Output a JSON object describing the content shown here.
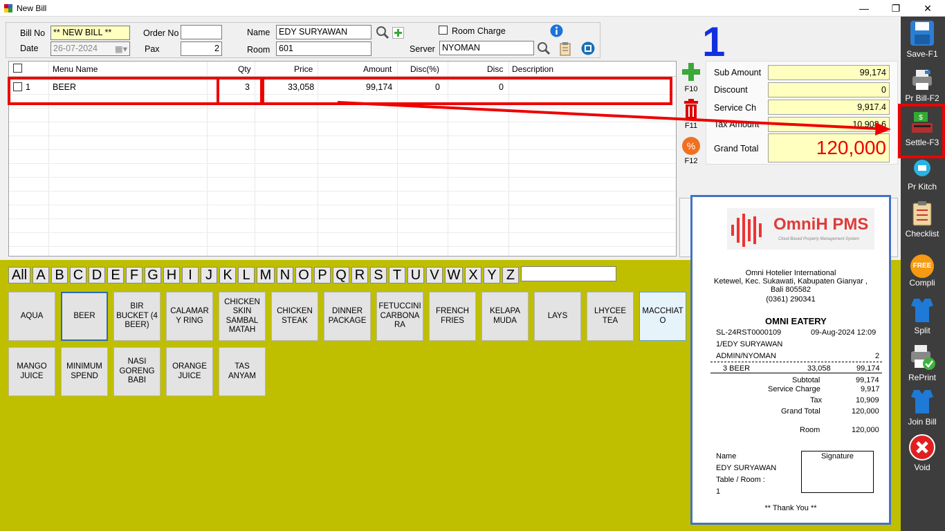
{
  "window": {
    "title": "New Bill",
    "minimize": "—",
    "maximize": "❐",
    "close": "✕"
  },
  "header": {
    "bill_no_label": "Bill No",
    "bill_no_value": "** NEW BILL **",
    "date_label": "Date",
    "date_value": "26-07-2024",
    "order_no_label": "Order No",
    "order_no_value": "",
    "pax_label": "Pax",
    "pax_value": "2",
    "name_label": "Name",
    "name_value": "EDY SURYAWAN",
    "room_label": "Room",
    "room_value": "601",
    "room_charge_label": "Room Charge",
    "server_label": "Server",
    "server_value": "NYOMAN",
    "big_number": "1"
  },
  "grid": {
    "columns": [
      "Menu Name",
      "Qty",
      "Price",
      "Amount",
      "Disc(%)",
      "Disc",
      "Description"
    ],
    "rows": [
      {
        "no": "1",
        "menu": "BEER",
        "qty": "3",
        "price": "33,058",
        "amount": "99,174",
        "disc_pct": "0",
        "disc": "0",
        "description": ""
      }
    ]
  },
  "fkeys": {
    "f10": "F10",
    "f11": "F11",
    "f12": "F12"
  },
  "totals": {
    "sub_amount_label": "Sub Amount",
    "sub_amount": "99,174",
    "discount_label": "Discount",
    "discount": "0",
    "service_label": "Service Ch",
    "service": "9,917.4",
    "tax_label": "Tax Amount",
    "tax": "10,908.6",
    "grand_label": "Grand Total",
    "grand": "120,000"
  },
  "alphabet": [
    "All",
    "A",
    "B",
    "C",
    "D",
    "E",
    "F",
    "G",
    "H",
    "I",
    "J",
    "K",
    "L",
    "M",
    "N",
    "O",
    "P",
    "Q",
    "R",
    "S",
    "T",
    "U",
    "V",
    "W",
    "X",
    "Y",
    "Z"
  ],
  "menu_items": [
    "AQUA",
    "BEER",
    "BIR BUCKET (4 BEER)",
    "CALAMAR Y RING",
    "CHICKEN SKIN SAMBAL MATAH",
    "CHICKEN STEAK",
    "DINNER PACKAGE",
    "FETUCCINI CARBONA RA",
    "FRENCH FRIES",
    "KELAPA MUDA",
    "LAYS",
    "LHYCEE TEA",
    "MACCHIAT O",
    "MANGO JUICE",
    "MINIMUM SPEND",
    "NASI GORENG BABI",
    "ORANGE JUICE",
    "TAS ANYAM"
  ],
  "sidebar": {
    "save": "Save-F1",
    "print_bill": "Pr Bill-F2",
    "settle": "Settle-F3",
    "print_kitchen": "Pr Kitch",
    "checklist": "Checklist",
    "free_badge": "FREE",
    "compli": "Compli",
    "split": "Split",
    "reprint": "RePrint",
    "join": "Join Bill",
    "void": "Void"
  },
  "receipt": {
    "logo": "OmniH PMS",
    "logo_sub": "Cloud Based Property Management System",
    "company": "Omni Hotelier International",
    "address1": "Ketewel, Kec. Sukawati, Kabupaten Gianyar ,",
    "address2": "Bali 805582",
    "phone": "(0361) 290341",
    "outlet": "OMNI EATERY",
    "bill_no": "SL-24RST0000109",
    "datetime": "09-Aug-2024 12:09",
    "guest_line": "1/EDY SURYAWAN",
    "user_line": "ADMIN/NYOMAN",
    "pax": "2",
    "item_line": "3  BEER",
    "item_price": "33,058",
    "item_amount": "99,174",
    "subtotal_label": "Subtotal",
    "subtotal": "99,174",
    "service_label": "Service Charge",
    "service": "9,917",
    "tax_label": "Tax",
    "tax": "10,909",
    "grand_label": "Grand Total",
    "grand": "120,000",
    "room_label": "Room",
    "room": "120,000",
    "name_label": "Name",
    "name_value": "EDY SURYAWAN",
    "table_label": "Table / Room :",
    "table_value": "1",
    "signature_label": "Signature",
    "thanks": "** Thank You **"
  },
  "colors": {
    "accent_red": "#e00000",
    "panel_olive": "#bfbf00",
    "sidebar": "#3d3d3d",
    "receipt_border": "#4472c4"
  }
}
